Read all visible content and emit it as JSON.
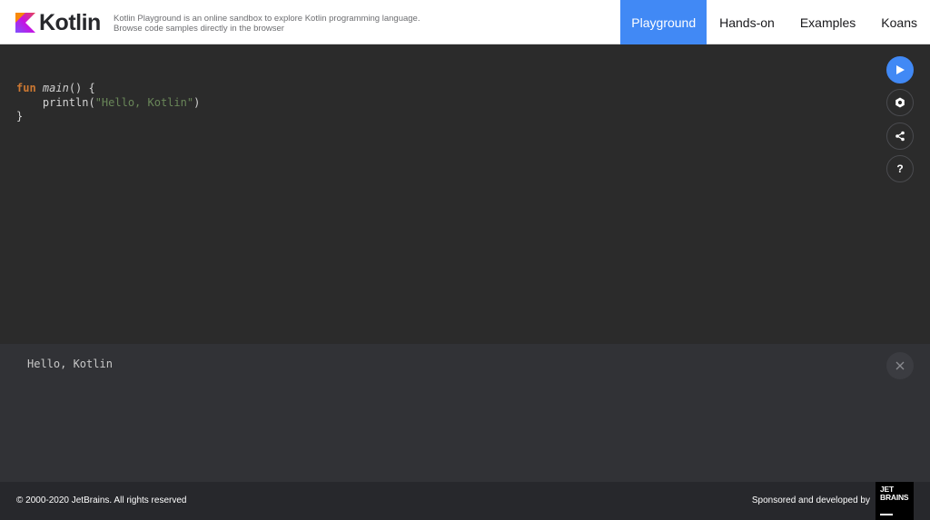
{
  "header": {
    "brand": "Kotlin",
    "tagline": "Kotlin Playground is an online sandbox to explore Kotlin programming language. Browse code samples directly in the browser",
    "nav": [
      {
        "label": "Playground",
        "active": true
      },
      {
        "label": "Hands-on",
        "active": false
      },
      {
        "label": "Examples",
        "active": false
      },
      {
        "label": "Koans",
        "active": false
      }
    ]
  },
  "editor": {
    "code": {
      "kw_fun": "fun",
      "fn_name": "main",
      "line1_rest": "() {",
      "line2_indent": "    ",
      "line2_call": "println(",
      "line2_string": "\"Hello, Kotlin\"",
      "line2_close": ")",
      "line3": "}"
    },
    "toolbar": [
      "play-icon",
      "gear-icon",
      "share-icon",
      "help-icon"
    ],
    "help_label": "?"
  },
  "output": {
    "text": "Hello, Kotlin"
  },
  "footer": {
    "copyright": "© 2000-2020 JetBrains. All rights reserved",
    "sponsor": "Sponsored and developed by",
    "logo_line1": "JET",
    "logo_line2": "BRAINS"
  },
  "colors": {
    "accent": "#4189f5",
    "editor_bg": "#2b2b2b",
    "output_bg": "#313236",
    "footer_bg": "#27282c",
    "keyword": "#cc7832",
    "string": "#6a8759"
  }
}
